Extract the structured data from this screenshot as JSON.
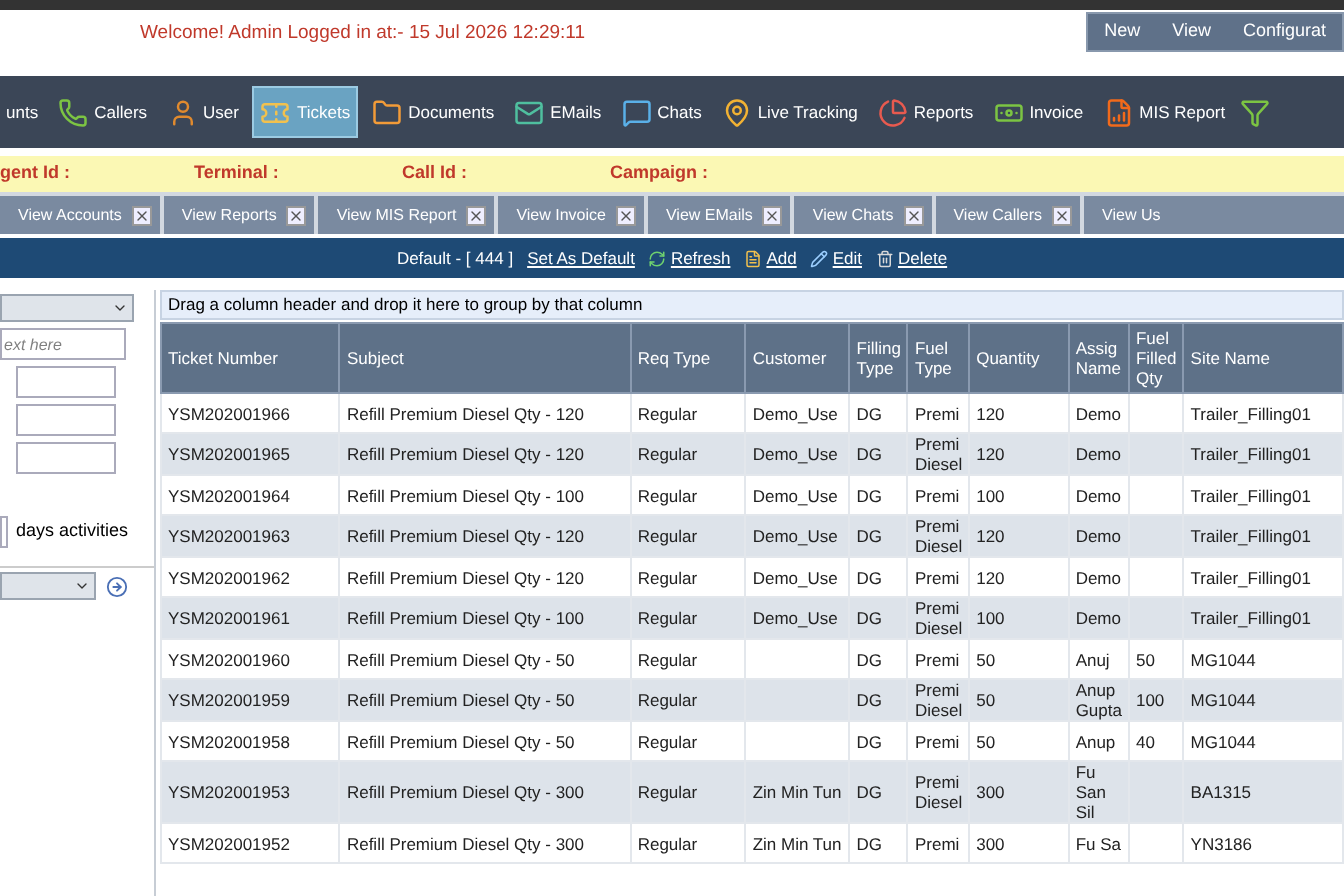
{
  "header": {
    "welcome": "Welcome! Admin Logged in at:- 15 Jul 2026 12:29:11",
    "menu": [
      "New",
      "View",
      "Configurat"
    ]
  },
  "nav": [
    {
      "label": "unts",
      "selected": false
    },
    {
      "label": "Callers",
      "selected": false
    },
    {
      "label": "User",
      "selected": false
    },
    {
      "label": "Tickets",
      "selected": true
    },
    {
      "label": "Documents",
      "selected": false
    },
    {
      "label": "EMails",
      "selected": false
    },
    {
      "label": "Chats",
      "selected": false
    },
    {
      "label": "Live Tracking",
      "selected": false
    },
    {
      "label": "Reports",
      "selected": false
    },
    {
      "label": "Invoice",
      "selected": false
    },
    {
      "label": "MIS Report",
      "selected": false
    }
  ],
  "info_bar": [
    "gent Id :",
    "Terminal :",
    "Call Id :",
    "Campaign :"
  ],
  "tabs": [
    "View Accounts",
    "View Reports",
    "View MIS Report",
    "View Invoice",
    "View EMails",
    "View Chats",
    "View Callers",
    "View Us"
  ],
  "toolbar": {
    "view": "Default - [ 444 ]",
    "actions": [
      "Set As Default",
      "Refresh",
      "Add",
      "Edit",
      "Delete"
    ]
  },
  "sidebar": {
    "search": {
      "placeholder": "ext here"
    },
    "days_label": "days activities"
  },
  "grid": {
    "group_hint": "Drag a column header and drop it here to group by that column",
    "columns": [
      "Ticket Number",
      "Subject",
      "Req Type",
      "Customer",
      "Filling Type",
      "Fuel Type",
      "Quantity",
      "Assig Name",
      "Fuel Filled Qty",
      "Site Name"
    ],
    "rows": [
      [
        "YSM202001966",
        "Refill Premium Diesel Qty - 120",
        "Regular",
        "Demo_Use",
        "DG",
        "Premi",
        "120",
        "Demo",
        null,
        "Trailer_Filling01"
      ],
      [
        "YSM202001965",
        "Refill Premium Diesel Qty - 120",
        "Regular",
        "Demo_Use",
        "DG",
        "Premi Diesel",
        "120",
        "Demo",
        null,
        "Trailer_Filling01"
      ],
      [
        "YSM202001964",
        "Refill Premium Diesel Qty - 100",
        "Regular",
        "Demo_Use",
        "DG",
        "Premi",
        "100",
        "Demo",
        null,
        "Trailer_Filling01"
      ],
      [
        "YSM202001963",
        "Refill Premium Diesel Qty - 120",
        "Regular",
        "Demo_Use",
        "DG",
        "Premi Diesel",
        "120",
        "Demo",
        null,
        "Trailer_Filling01"
      ],
      [
        "YSM202001962",
        "Refill Premium Diesel Qty - 120",
        "Regular",
        "Demo_Use",
        "DG",
        "Premi",
        "120",
        "Demo",
        null,
        "Trailer_Filling01"
      ],
      [
        "YSM202001961",
        "Refill Premium Diesel Qty - 100",
        "Regular",
        "Demo_Use",
        "DG",
        "Premi Diesel",
        "100",
        "Demo",
        null,
        "Trailer_Filling01"
      ],
      [
        "YSM202001960",
        "Refill Premium Diesel Qty - 50",
        "Regular",
        null,
        "DG",
        "Premi",
        "50",
        "Anuj",
        "50",
        "MG1044"
      ],
      [
        "YSM202001959",
        "Refill Premium Diesel Qty - 50",
        "Regular",
        null,
        "DG",
        "Premi Diesel",
        "50",
        "Anup Gupta",
        "100",
        "MG1044"
      ],
      [
        "YSM202001958",
        "Refill Premium Diesel Qty - 50",
        "Regular",
        null,
        "DG",
        "Premi",
        "50",
        "Anup",
        "40",
        "MG1044"
      ],
      [
        "YSM202001953",
        "Refill Premium Diesel Qty - 300",
        "Regular",
        "Zin Min Tun",
        "DG",
        "Premi Diesel",
        "300",
        "Fu San Sil",
        null,
        "BA1315"
      ],
      [
        "YSM202001952",
        "Refill Premium Diesel Qty - 300",
        "Regular",
        "Zin Min Tun",
        "DG",
        "Premi",
        "300",
        "Fu Sa",
        null,
        "YN3186"
      ]
    ]
  }
}
